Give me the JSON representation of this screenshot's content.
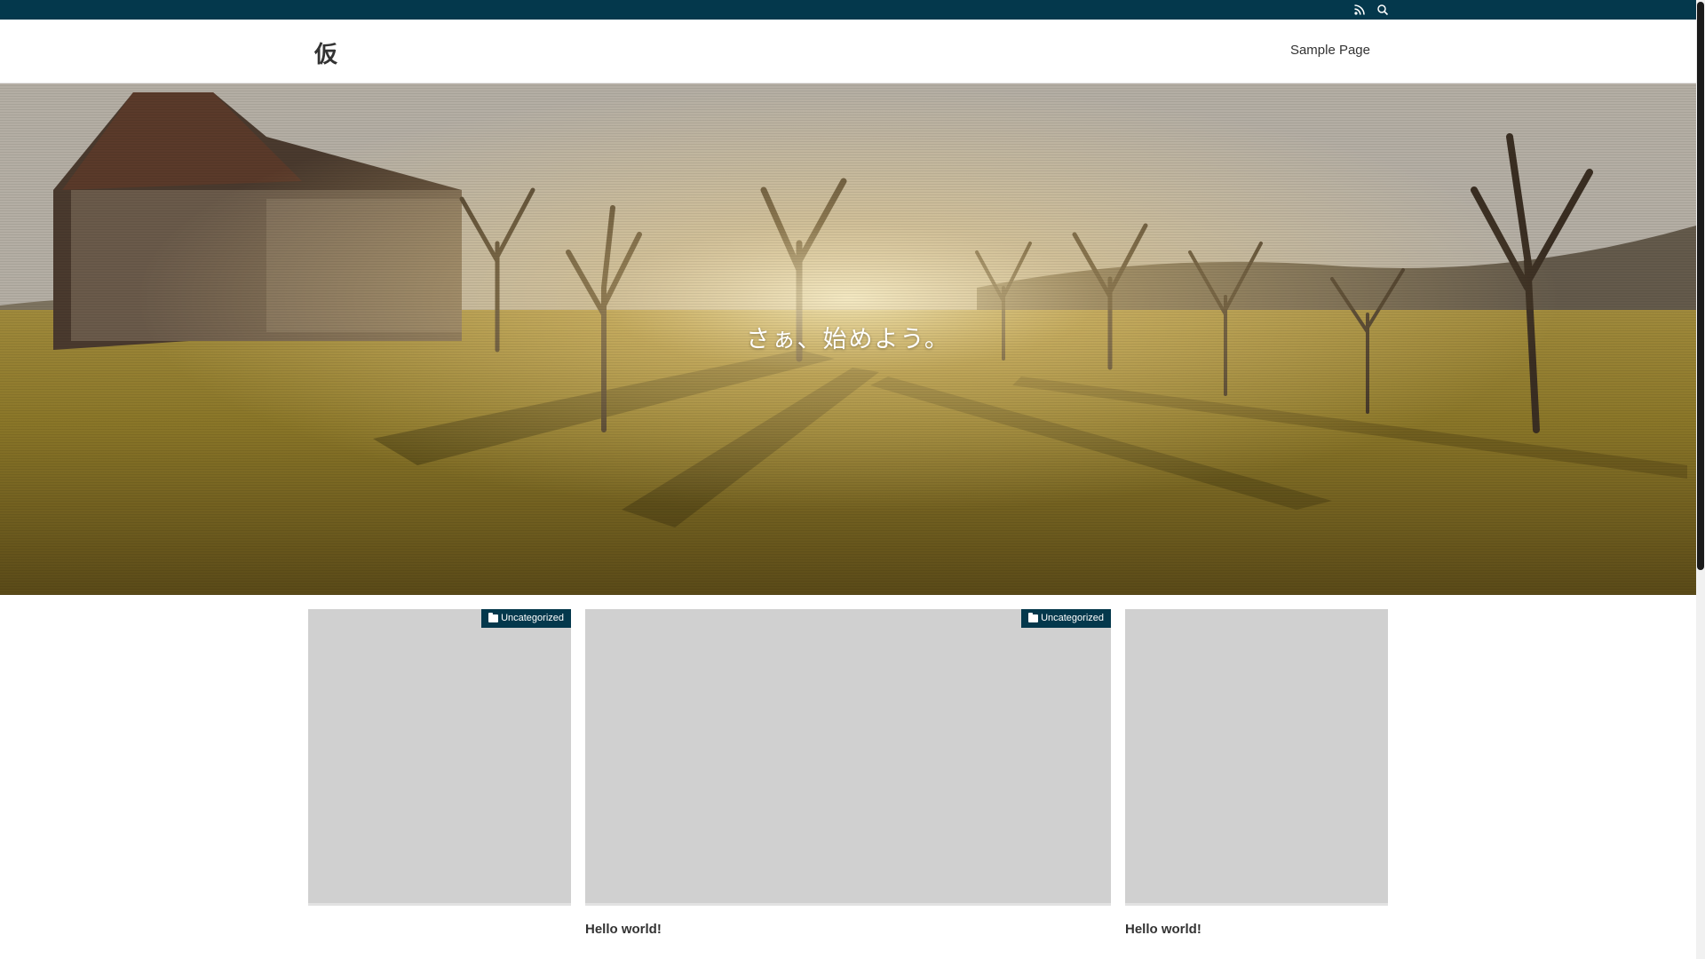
{
  "site": {
    "title": "仮"
  },
  "nav": {
    "items": [
      {
        "label": "Sample Page"
      }
    ]
  },
  "topbar": {
    "icons": [
      "rss-icon",
      "search-icon"
    ]
  },
  "hero": {
    "title": "さぁ、始めよう。"
  },
  "posts": [
    {
      "category": "Uncategorized",
      "title": ""
    },
    {
      "category": "Uncategorized",
      "title": "Hello world!"
    },
    {
      "category": "",
      "title": "Hello world!"
    }
  ],
  "colors": {
    "accent": "#04384c",
    "thumb_placeholder": "#d0d0d0"
  }
}
